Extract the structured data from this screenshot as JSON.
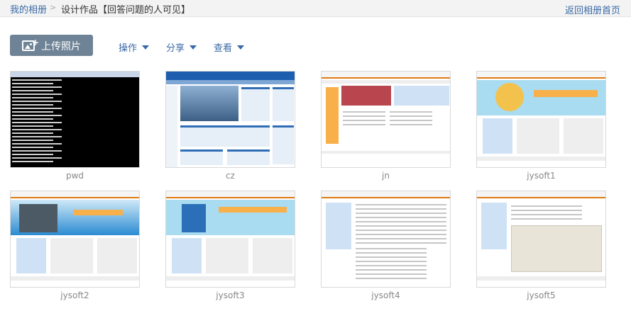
{
  "breadcrumb": {
    "home": "我的相册",
    "separator": ">",
    "current": "设计作品【回答问题的人可见】"
  },
  "back_link": "返回相册首页",
  "toolbar": {
    "upload_label": "上传照片",
    "upload_icon": "add-photo-icon",
    "menus": [
      "操作",
      "分享",
      "查看"
    ]
  },
  "photos": [
    {
      "name": "pwd"
    },
    {
      "name": "cz"
    },
    {
      "name": "jn"
    },
    {
      "name": "jysoft1"
    },
    {
      "name": "jysoft2"
    },
    {
      "name": "jysoft3"
    },
    {
      "name": "jysoft4"
    },
    {
      "name": "jysoft5"
    }
  ],
  "thumb_text": {
    "cmd_title": "F:\\Python27\\python.exe",
    "cmd_lines": [
      "500 Internal Server Error",
      "您输入的密码\"pkw6\"有误"
    ]
  },
  "colors": {
    "link": "#3b6aa6",
    "button": "#6f8396",
    "topbar": "#f3f3f3"
  }
}
